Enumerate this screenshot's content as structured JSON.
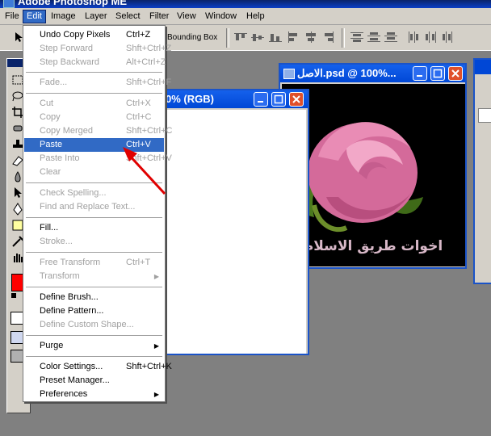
{
  "app": {
    "title": "Adobe Photoshop ME"
  },
  "menubar": {
    "items": [
      "File",
      "Edit",
      "Image",
      "Layer",
      "Select",
      "Filter",
      "View",
      "Window",
      "Help"
    ]
  },
  "options": {
    "bounding_box_label": "Bounding Box"
  },
  "edit_menu": {
    "items": [
      {
        "label": "Undo Copy Pixels",
        "shortcut": "Ctrl+Z",
        "enabled": true
      },
      {
        "label": "Step Forward",
        "shortcut": "Shft+Ctrl+Z",
        "enabled": false
      },
      {
        "label": "Step Backward",
        "shortcut": "Alt+Ctrl+Z",
        "enabled": false
      },
      {
        "label": "Fade...",
        "shortcut": "Shft+Ctrl+F",
        "enabled": false
      },
      {
        "label": "Cut",
        "shortcut": "Ctrl+X",
        "enabled": false
      },
      {
        "label": "Copy",
        "shortcut": "Ctrl+C",
        "enabled": false
      },
      {
        "label": "Copy Merged",
        "shortcut": "Shft+Ctrl+C",
        "enabled": false
      },
      {
        "label": "Paste",
        "shortcut": "Ctrl+V",
        "enabled": true,
        "highlighted": true
      },
      {
        "label": "Paste Into",
        "shortcut": "Shft+Ctrl+V",
        "enabled": false
      },
      {
        "label": "Clear",
        "shortcut": "",
        "enabled": false
      },
      {
        "label": "Check Spelling...",
        "shortcut": "",
        "enabled": false
      },
      {
        "label": "Find and Replace Text...",
        "shortcut": "",
        "enabled": false
      },
      {
        "label": "Fill...",
        "shortcut": "",
        "enabled": true
      },
      {
        "label": "Stroke...",
        "shortcut": "",
        "enabled": false
      },
      {
        "label": "Free Transform",
        "shortcut": "Ctrl+T",
        "enabled": false
      },
      {
        "label": "Transform",
        "shortcut": "",
        "enabled": false,
        "submenu": true
      },
      {
        "label": "Define Brush...",
        "shortcut": "",
        "enabled": true
      },
      {
        "label": "Define Pattern...",
        "shortcut": "",
        "enabled": true
      },
      {
        "label": "Define Custom Shape...",
        "shortcut": "",
        "enabled": false
      },
      {
        "label": "Purge",
        "shortcut": "",
        "enabled": true,
        "submenu": true
      },
      {
        "label": "Color Settings...",
        "shortcut": "Shft+Ctrl+K",
        "enabled": true
      },
      {
        "label": "Preset Manager...",
        "shortcut": "",
        "enabled": true
      },
      {
        "label": "Preferences",
        "shortcut": "",
        "enabled": true,
        "submenu": true
      }
    ]
  },
  "doc_new": {
    "title": "0% (RGB)"
  },
  "doc_rose": {
    "title": "الاصل.psd @ 100%...",
    "caption": "اخوات طريق الاسلام"
  },
  "colors": {
    "foreground": "#ff0000",
    "background": "#ffffff",
    "accent": "#316ac5"
  }
}
